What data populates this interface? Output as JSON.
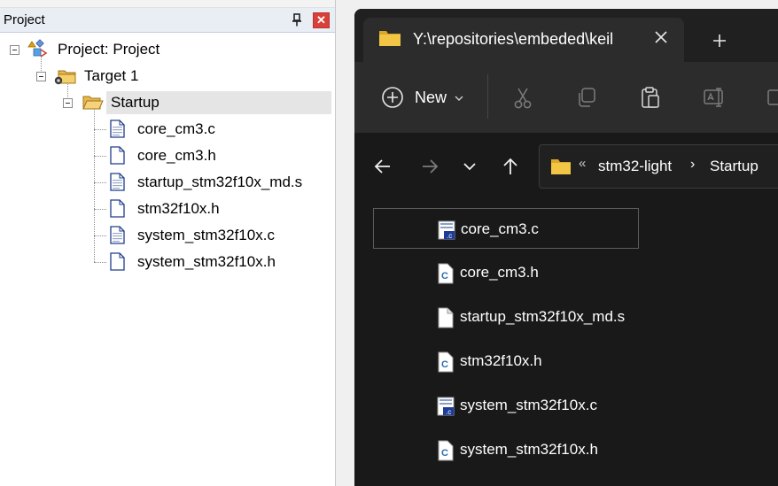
{
  "project_pane": {
    "title": "Project",
    "close_label": "✕",
    "root": {
      "label": "Project: Project"
    },
    "target": {
      "label": "Target 1"
    },
    "group": {
      "label": "Startup"
    },
    "files": [
      {
        "label": "core_cm3.c",
        "icon": "c-source-file-icon"
      },
      {
        "label": "core_cm3.h",
        "icon": "header-file-icon"
      },
      {
        "label": "startup_stm32f10x_md.s",
        "icon": "asm-file-icon"
      },
      {
        "label": "stm32f10x.h",
        "icon": "header-file-icon"
      },
      {
        "label": "system_stm32f10x.c",
        "icon": "c-source-file-icon"
      },
      {
        "label": "system_stm32f10x.h",
        "icon": "header-file-icon"
      }
    ]
  },
  "explorer": {
    "tab_title": "Y:\\repositories\\embeded\\keil",
    "new_label": "New",
    "breadcrumb": {
      "parent": "stm32-light",
      "current": "Startup"
    },
    "files": [
      {
        "name": "core_cm3.c",
        "icon": "c-file-icon",
        "selected": true
      },
      {
        "name": "core_cm3.h",
        "icon": "h-file-icon",
        "selected": false
      },
      {
        "name": "startup_stm32f10x_md.s",
        "icon": "generic-file-icon",
        "selected": false
      },
      {
        "name": "stm32f10x.h",
        "icon": "h-file-icon",
        "selected": false
      },
      {
        "name": "system_stm32f10x.c",
        "icon": "c-file-icon",
        "selected": false
      },
      {
        "name": "system_stm32f10x.h",
        "icon": "h-file-icon",
        "selected": false
      }
    ],
    "colors": {
      "background": "#191919",
      "command_bar": "#2c2c2c",
      "folder": "#f0c040"
    }
  }
}
